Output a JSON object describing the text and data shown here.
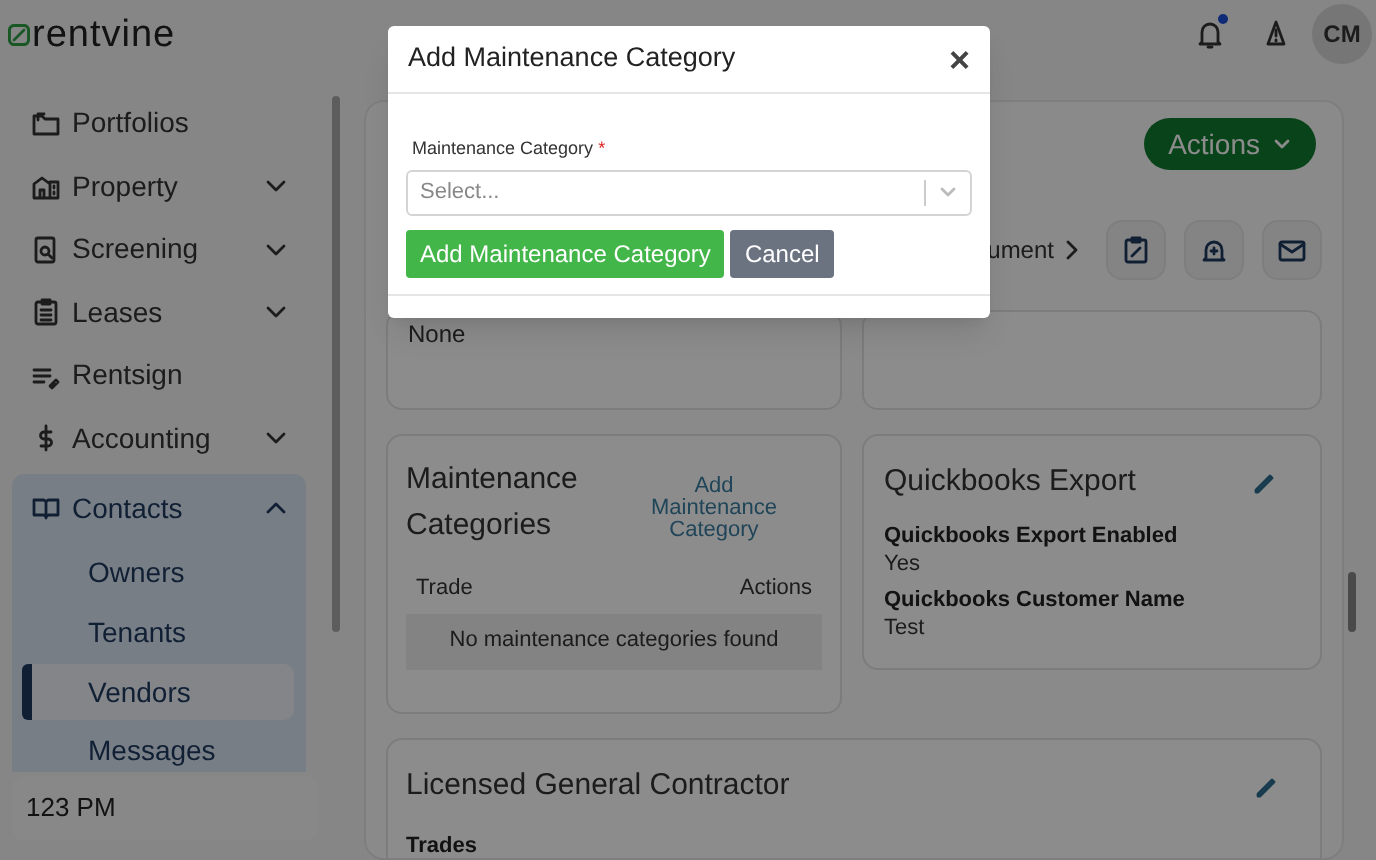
{
  "brand": {
    "logo_text": "rentvine"
  },
  "topbar": {
    "avatar": "CM",
    "notification_dot": true
  },
  "sidebar": {
    "items": [
      {
        "label": "Portfolios"
      },
      {
        "label": "Property",
        "expanded": false
      },
      {
        "label": "Screening",
        "expanded": false
      },
      {
        "label": "Leases",
        "expanded": false
      },
      {
        "label": "Rentsign"
      },
      {
        "label": "Accounting",
        "expanded": false
      },
      {
        "label": "Contacts",
        "expanded": true,
        "children": [
          {
            "label": "Owners",
            "selected": false
          },
          {
            "label": "Tenants",
            "selected": false
          },
          {
            "label": "Vendors",
            "selected": true
          },
          {
            "label": "Messages",
            "selected": false
          }
        ]
      }
    ],
    "footer": "123 PM"
  },
  "main": {
    "actions_button": "Actions",
    "breadcrumb_fragment": "ument",
    "info_card": {
      "value": "None"
    },
    "maintenance": {
      "title": "Maintenance Categories",
      "add_link": "Add Maintenance Category",
      "columns": [
        "Trade",
        "Actions"
      ],
      "empty_message": "No maintenance categories found"
    },
    "quickbooks": {
      "title": "Quickbooks Export",
      "fields": [
        {
          "label": "Quickbooks Export Enabled",
          "value": "Yes"
        },
        {
          "label": "Quickbooks Customer Name",
          "value": "Test"
        }
      ]
    },
    "contractor": {
      "title": "Licensed General Contractor",
      "fields": [
        {
          "label": "Trades"
        }
      ]
    }
  },
  "modal": {
    "title": "Add Maintenance Category",
    "close": "×",
    "field_label": "Maintenance Category",
    "required_mark": "*",
    "placeholder": "Select...",
    "buttons": [
      {
        "label": "Add Maintenance Category",
        "kind": "primary"
      },
      {
        "label": "Cancel",
        "kind": "secondary"
      }
    ]
  }
}
